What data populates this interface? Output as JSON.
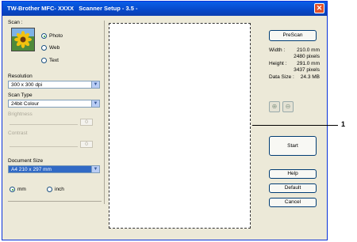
{
  "window": {
    "title": "TW-Brother MFC- XXXX   Scanner Setup - 3.5 -",
    "close_glyph": "✕"
  },
  "scan": {
    "label": "Scan :",
    "options": [
      "Photo",
      "Web",
      "Text"
    ],
    "selected": "Photo"
  },
  "resolution": {
    "label": "Resolution",
    "value": "300 x 300 dpi"
  },
  "scan_type": {
    "label": "Scan Type",
    "value": "24bit Colour"
  },
  "brightness": {
    "label": "Brightness",
    "value": "0"
  },
  "contrast": {
    "label": "Contrast",
    "value": "0"
  },
  "document_size": {
    "label": "Document Size",
    "value": "A4 210 x 297 mm"
  },
  "units": {
    "options": [
      "mm",
      "inch"
    ],
    "selected": "mm"
  },
  "prescan_label": "PreScan",
  "info": {
    "width_label": "Width :",
    "width_mm": "210.0 mm",
    "width_px": "2480 pixels",
    "height_label": "Height :",
    "height_mm": "291.0 mm",
    "height_px": "3437 pixels",
    "datasize_label": "Data Size :",
    "datasize": "24.3 MB"
  },
  "buttons": {
    "start": "Start",
    "help": "Help",
    "default": "Default",
    "cancel": "Cancel"
  },
  "icons": {
    "zoom_in": "zoom-in-icon",
    "zoom_out": "zoom-out-icon",
    "sunflower": "sunflower-image"
  },
  "callout": {
    "number": "1"
  }
}
